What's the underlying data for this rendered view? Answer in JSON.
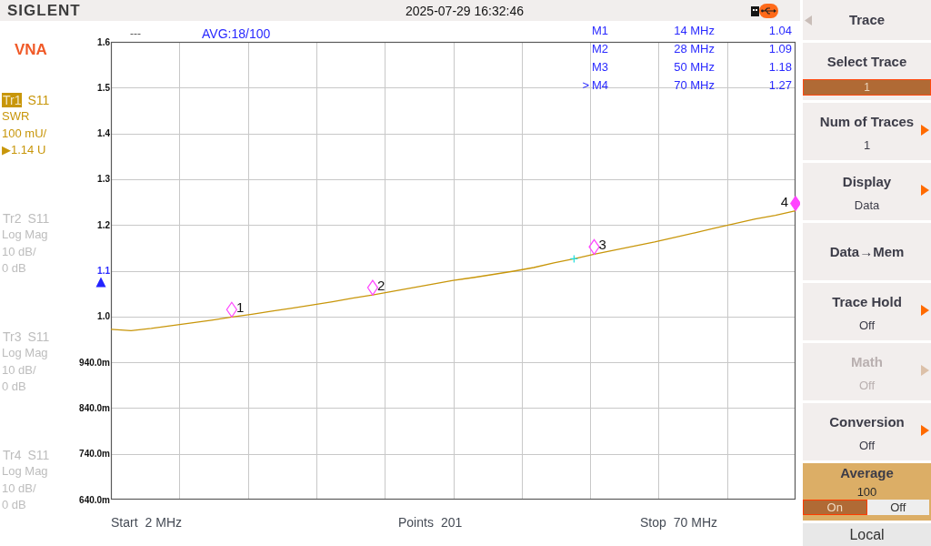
{
  "top_bar": {
    "logo": "SIGLENT",
    "datetime": "2025-07-29 16:32:46"
  },
  "mode": "VNA",
  "traces": [
    {
      "name": "Tr1",
      "parameter": "S11",
      "format": "SWR",
      "scale": "100 mU/",
      "reference": "▶1.14 U",
      "selected": true,
      "enabled": true
    },
    {
      "name": "Tr2",
      "parameter": "S11",
      "format": "Log Mag",
      "scale": "10 dB/",
      "reference": "0 dB",
      "selected": false,
      "enabled": false
    },
    {
      "name": "Tr3",
      "parameter": "S11",
      "format": "Log Mag",
      "scale": "10 dB/",
      "reference": "0 dB",
      "selected": false,
      "enabled": false
    },
    {
      "name": "Tr4",
      "parameter": "S11",
      "format": "Log Mag",
      "scale": "10 dB/",
      "reference": "0 dB",
      "selected": false,
      "enabled": false
    }
  ],
  "plot_status": {
    "indicator": "---",
    "averaging": "AVG:18/100"
  },
  "marker_table": {
    "active_pointer": ">",
    "rows": [
      {
        "tag": "1",
        "name": "M1",
        "stimulus": "14 MHz",
        "value": "1.04",
        "selected": false
      },
      {
        "tag": "2",
        "name": "M2",
        "stimulus": "28 MHz",
        "value": "1.09",
        "selected": false
      },
      {
        "tag": "3",
        "name": "M3",
        "stimulus": "50 MHz",
        "value": "1.18",
        "selected": false
      },
      {
        "tag": "4",
        "name": "M4",
        "stimulus": "70 MHz",
        "value": "1.27",
        "selected": true
      }
    ]
  },
  "chart": {
    "chart_data": {
      "type": "line",
      "categories": [
        null,
        null,
        null,
        null,
        null,
        null,
        null,
        null,
        null,
        null,
        null,
        null,
        null,
        null,
        null,
        null,
        null,
        null,
        null,
        null,
        null,
        null,
        null,
        null,
        null,
        null,
        null,
        null,
        null,
        null,
        null,
        null,
        null,
        null,
        null
      ],
      "series": [
        {
          "color": "#c8960a",
          "values": [
            0.972,
            0.969,
            0.974,
            0.98,
            0.986,
            0.992,
            0.999,
            1.005,
            1.012,
            1.018,
            1.025,
            1.032,
            1.04,
            1.047,
            1.055,
            1.063,
            1.071,
            1.079,
            1.085,
            1.092,
            1.099,
            1.107,
            1.117,
            1.126,
            1.136,
            1.145,
            1.154,
            1.163,
            1.173,
            1.183,
            1.193,
            1.203,
            1.213,
            1.221,
            1.231
          ]
        },
        {
          "type": "scatter",
          "color": "#ff44ff",
          "values": [
            null,
            null,
            null,
            null,
            null,
            null,
            1.015,
            null,
            null,
            null,
            null,
            null,
            null,
            1.063,
            null,
            null,
            null,
            null,
            null,
            null,
            null,
            null,
            null,
            null,
            1.152,
            null,
            null,
            null,
            null,
            null,
            null,
            null,
            null,
            null,
            1.247
          ]
        },
        {
          "type": "scatter",
          "color": "#22dddd",
          "values": [
            null,
            null,
            null,
            null,
            null,
            null,
            null,
            null,
            null,
            null,
            null,
            null,
            null,
            null,
            null,
            null,
            null,
            null,
            null,
            null,
            null,
            null,
            null,
            1.126,
            null,
            null,
            null,
            null,
            null,
            null,
            null,
            null,
            null,
            null,
            null
          ]
        }
      ],
      "ylim": [
        0.6,
        1.6
      ],
      "yticks": [
        {
          "value": 1.6,
          "label": "1.6"
        },
        {
          "value": 1.5,
          "label": "1.5"
        },
        {
          "value": 1.4,
          "label": "1.4"
        },
        {
          "value": 1.3,
          "label": "1.3"
        },
        {
          "value": 1.2,
          "label": "1.2"
        },
        {
          "value": 1.1,
          "label": "1.1"
        },
        {
          "value": 1.0,
          "label": "1.0"
        }
      ],
      "grid": true
    },
    "lower_axis_labels": [
      "940.0m",
      "840.0m",
      "740.0m",
      "640.0m"
    ]
  },
  "footer": [
    {
      "label": "Start",
      "value": "2 MHz"
    },
    {
      "label": "Points",
      "value": "201"
    },
    {
      "label": "Stop",
      "value": "70 MHz"
    }
  ],
  "softkeys": {
    "title": "Trace",
    "items": [
      {
        "kind": "select",
        "label": "Select Trace",
        "value": "1",
        "disabled": false
      },
      {
        "kind": "submenu",
        "label": "Num of Traces",
        "value": "1",
        "disabled": false
      },
      {
        "kind": "submenu",
        "label": "Display",
        "value": "Data",
        "disabled": false
      },
      {
        "kind": "action",
        "label": "Data→Mem",
        "disabled": false
      },
      {
        "kind": "submenu",
        "label": "Trace Hold",
        "value": "Off",
        "disabled": false
      },
      {
        "kind": "submenu",
        "label": "Math",
        "value": "Off",
        "disabled": true
      },
      {
        "kind": "submenu",
        "label": "Conversion",
        "value": "Off",
        "disabled": false
      },
      {
        "kind": "toggle",
        "label": "Average",
        "value": "100",
        "disabled": false,
        "options": [
          {
            "label": "On",
            "selected": true
          },
          {
            "label": "Off",
            "selected": false
          }
        ]
      }
    ],
    "local": "Local"
  }
}
